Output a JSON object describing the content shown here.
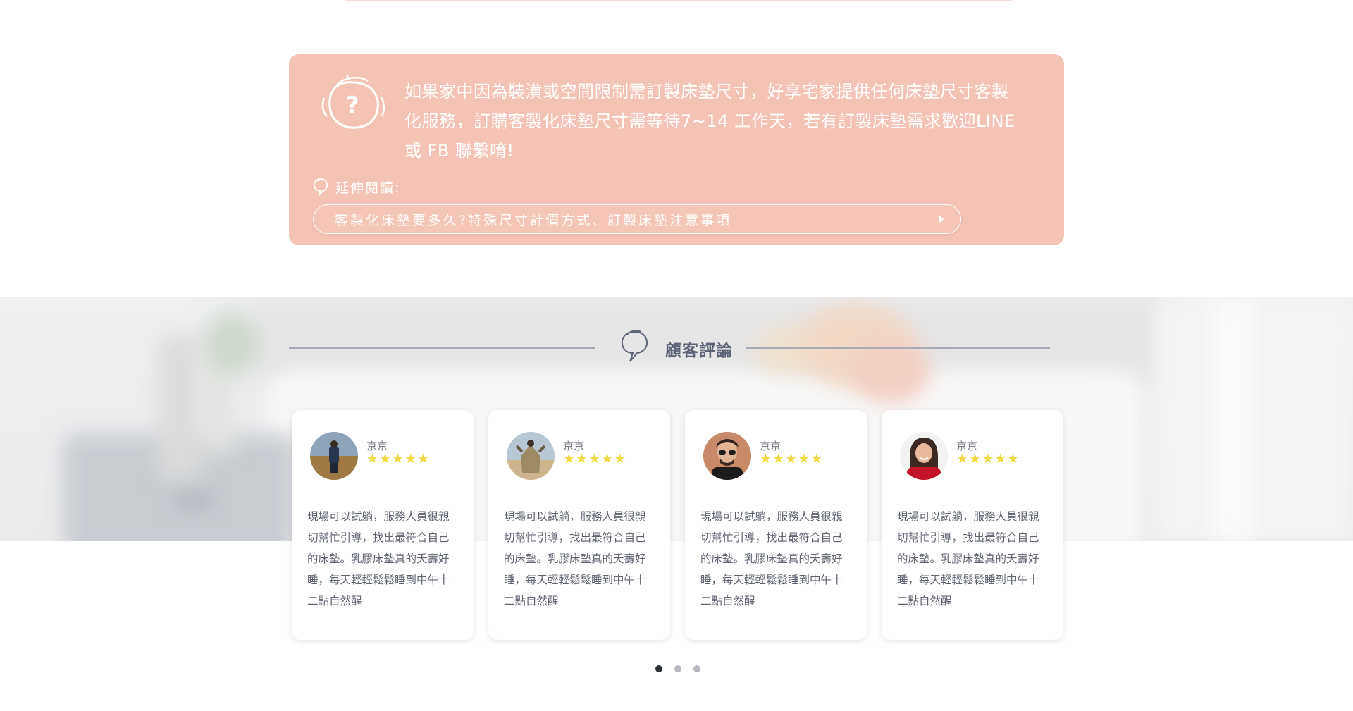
{
  "info": {
    "text": "如果家中因為裝潢或空間限制需訂製床墊尺寸，好享宅家提供任何床墊尺寸客製化服務，訂購客製化床墊尺寸需等待7~14 工作天，若有訂製床墊需求歡迎LINE 或 FB 聯繫唷!",
    "extend_label": "延伸閱讀:",
    "extend_link": "客製化床墊要多久?特殊尺寸計價方式、訂製床墊注意事項"
  },
  "reviews": {
    "title": "顧客評論",
    "star_string": "★★★★★",
    "items": [
      {
        "name": "京京",
        "rating": 5,
        "text": "現場可以試躺，服務人員很親切幫忙引導，找出最符合自己的床墊。乳膠床墊真的夭壽好睡，每天輕輕鬆鬆睡到中午十二點自然醒"
      },
      {
        "name": "京京",
        "rating": 5,
        "text": "現場可以試躺，服務人員很親切幫忙引導，找出最符合自己的床墊。乳膠床墊真的夭壽好睡，每天輕輕鬆鬆睡到中午十二點自然醒"
      },
      {
        "name": "京京",
        "rating": 5,
        "text": "現場可以試躺，服務人員很親切幫忙引導，找出最符合自己的床墊。乳膠床墊真的夭壽好睡，每天輕輕鬆鬆睡到中午十二點自然醒"
      },
      {
        "name": "京京",
        "rating": 5,
        "text": "現場可以試躺，服務人員很親切幫忙引導，找出最符合自己的床墊。乳膠床墊真的夭壽好睡，每天輕輕鬆鬆睡到中午十二點自然醒"
      }
    ]
  },
  "pagination": {
    "total": 3,
    "active": 0
  },
  "colors": {
    "info_bg": "#f5c3b5",
    "title": "#5d6478",
    "star": "#f0da45",
    "dot_active": "#2b2e35",
    "dot_inactive": "#b5b8bf"
  }
}
